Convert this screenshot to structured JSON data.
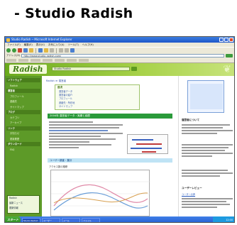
{
  "caption": "- Studio Radish",
  "browser": {
    "title": "Studio Radish ─ Microsoft Internet Explorer",
    "menu": [
      "ファイル(F)",
      "編集(E)",
      "表示(V)",
      "お気に入り(A)",
      "ツール(T)",
      "ヘルプ(H)"
    ],
    "address_label": "アドレス(D)",
    "address": "http://www.studio-radish.com/"
  },
  "site": {
    "logo": "Radish",
    "search_text": "Studio Radish",
    "breadcrumb": "Radish ≫ 運営者",
    "nav": [
      {
        "label": "ソフトウェア",
        "kind": "main"
      },
      {
        "label": "Radish",
        "kind": "sub"
      },
      {
        "label": "運営者",
        "kind": "main"
      },
      {
        "label": "プロフィール",
        "kind": "sub"
      },
      {
        "label": "連絡先",
        "kind": "sub"
      },
      {
        "label": "サイトマップ",
        "kind": "sub"
      },
      {
        "label": "ブログ",
        "kind": "main"
      },
      {
        "label": "カテゴリ",
        "kind": "sub"
      },
      {
        "label": "アーカイブ",
        "kind": "sub"
      },
      {
        "label": "リンク",
        "kind": "main"
      },
      {
        "label": "お知らせ",
        "kind": "sub"
      },
      {
        "label": "更新履歴",
        "kind": "sub"
      },
      {
        "label": "ダウンロード",
        "kind": "main"
      },
      {
        "label": "FAQ",
        "kind": "sub"
      }
    ],
    "nav_box": {
      "title": "Radish",
      "lines": [
        "最新ニュース",
        "更新情報"
      ]
    },
    "summary": {
      "title": "目次",
      "lines": [
        "運営者データ",
        "運営者の紹介",
        "プロフィール",
        "連絡先・所在地",
        "サイトマップ"
      ]
    },
    "section1": "2004年 運営者データ・実績と経歴",
    "section2": "ユーザー調査・集計",
    "chart_title": "アクセス数の推移",
    "right": {
      "heading1": "運営者について",
      "heading2": "ユーザーレビュー",
      "link": "ユーザーの声"
    }
  },
  "taskbar": {
    "start": "スタート",
    "tasks": [
      "Studio Radish",
      "ユーザー",
      "メール",
      "ファイル"
    ],
    "clock": "12:00"
  }
}
